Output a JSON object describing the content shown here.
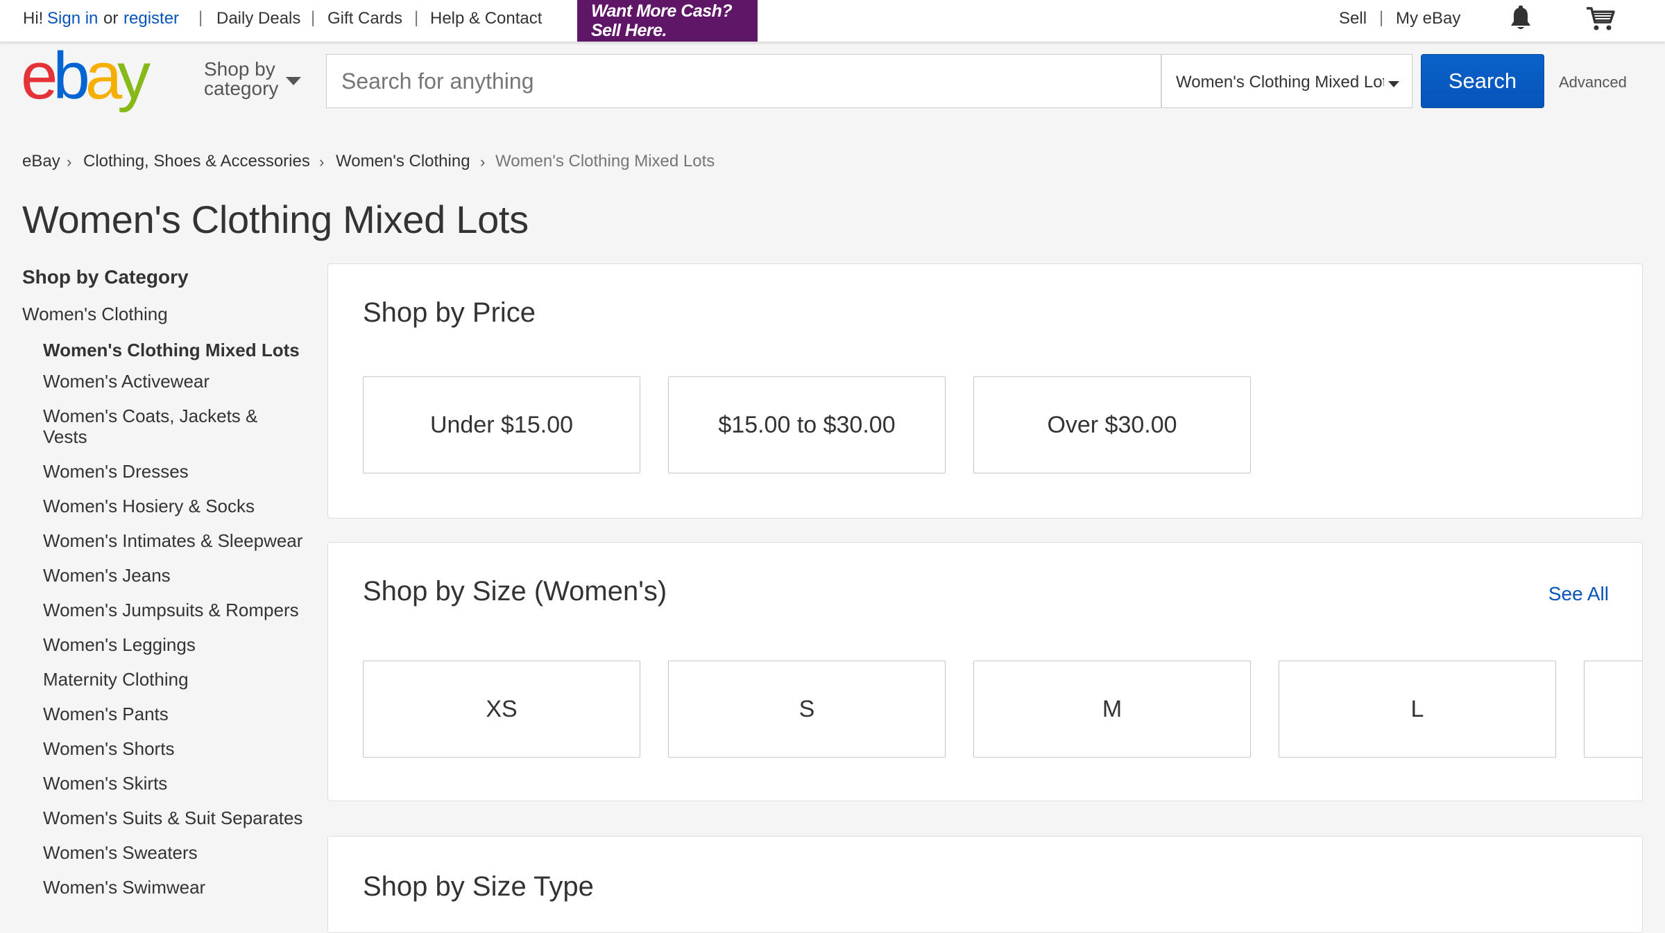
{
  "topbar": {
    "greeting": "Hi!",
    "sign_in": "Sign in",
    "or": "or",
    "register": "register",
    "links": [
      "Daily Deals",
      "Gift Cards",
      "Help & Contact"
    ],
    "promo_line1": "Want More Cash?",
    "promo_line2": "Sell Here.",
    "sell": "Sell",
    "my_ebay": "My eBay",
    "bell_icon": "bell-icon",
    "cart_icon": "cart-icon"
  },
  "header": {
    "logo": "ebay",
    "shop_by_line1": "Shop by",
    "shop_by_line2": "category",
    "search_placeholder": "Search for anything",
    "search_value": "",
    "category_selected": "Women's Clothing Mixed Lots",
    "search_button": "Search",
    "advanced": "Advanced",
    "brand_colors": [
      "#e53238",
      "#0064d2",
      "#f5af02",
      "#86b817"
    ]
  },
  "breadcrumb": [
    "eBay",
    "Clothing, Shoes & Accessories",
    "Women's Clothing",
    "Women's Clothing Mixed Lots"
  ],
  "page_title": "Women's Clothing Mixed Lots",
  "sidebar": {
    "heading": "Shop by Category",
    "parent": "Women's Clothing",
    "items": [
      {
        "label": "Women's Clothing Mixed Lots",
        "active": true
      },
      {
        "label": "Women's Activewear"
      },
      {
        "label": "Women's Coats, Jackets & Vests"
      },
      {
        "label": "Women's Dresses"
      },
      {
        "label": "Women's Hosiery & Socks"
      },
      {
        "label": "Women's Intimates & Sleepwear"
      },
      {
        "label": "Women's Jeans"
      },
      {
        "label": "Women's Jumpsuits & Rompers"
      },
      {
        "label": "Women's Leggings"
      },
      {
        "label": "Maternity Clothing"
      },
      {
        "label": "Women's Pants"
      },
      {
        "label": "Women's Shorts"
      },
      {
        "label": "Women's Skirts"
      },
      {
        "label": "Women's Suits & Suit Separates"
      },
      {
        "label": "Women's Sweaters"
      },
      {
        "label": "Women's Swimwear"
      }
    ]
  },
  "price_panel": {
    "title": "Shop by Price",
    "tiles": [
      "Under $15.00",
      "$15.00 to $30.00",
      "Over $30.00"
    ]
  },
  "size_panel": {
    "title": "Shop by Size (Women's)",
    "see_all": "See All",
    "tiles": [
      "XS",
      "S",
      "M",
      "L"
    ]
  },
  "size_type_panel": {
    "title": "Shop by Size Type"
  },
  "colors": {
    "link_blue": "#0654ba",
    "promo_purple": "#5f1667"
  }
}
